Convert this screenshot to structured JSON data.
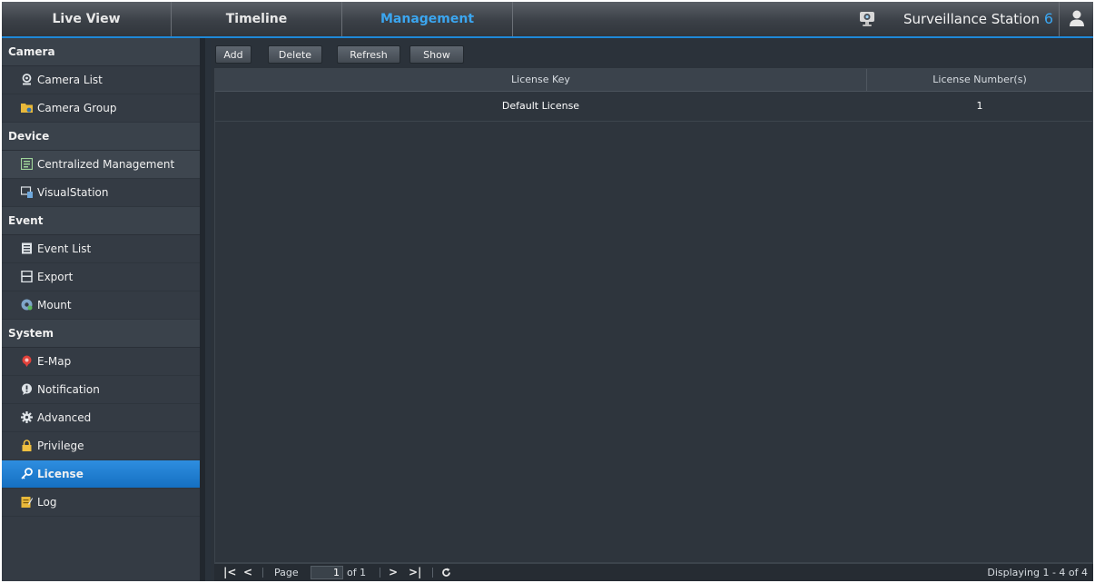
{
  "header": {
    "tabs": [
      {
        "label": "Live View"
      },
      {
        "label": "Timeline"
      },
      {
        "label": "Management"
      }
    ],
    "brand_text": "Surveillance Station",
    "brand_version": "6"
  },
  "sidebar": {
    "sections": [
      {
        "title": "Camera"
      },
      {
        "title": "Device"
      },
      {
        "title": "Event"
      },
      {
        "title": "System"
      }
    ],
    "items": [
      {
        "label": "Camera List"
      },
      {
        "label": "Camera Group"
      },
      {
        "label": "Centralized Management"
      },
      {
        "label": "VisualStation"
      },
      {
        "label": "Event List"
      },
      {
        "label": "Export"
      },
      {
        "label": "Mount"
      },
      {
        "label": "E-Map"
      },
      {
        "label": "Notification"
      },
      {
        "label": "Advanced"
      },
      {
        "label": "Privilege"
      },
      {
        "label": "License"
      },
      {
        "label": "Log"
      }
    ],
    "selected": "License"
  },
  "toolbar": {
    "add_label": "Add",
    "delete_label": "Delete",
    "refresh_label": "Refresh",
    "show_label": "Show"
  },
  "table": {
    "columns": [
      "License Key",
      "License Number(s)"
    ],
    "rows": [
      [
        "Default License",
        "1"
      ]
    ]
  },
  "pager": {
    "page_label": "Page",
    "page_value": "1",
    "of_label": "of 1",
    "display_text": "Displaying 1 - 4 of 4"
  },
  "colors": {
    "accent": "#3ba6f0",
    "selected_bg": "#1e7fd4"
  }
}
